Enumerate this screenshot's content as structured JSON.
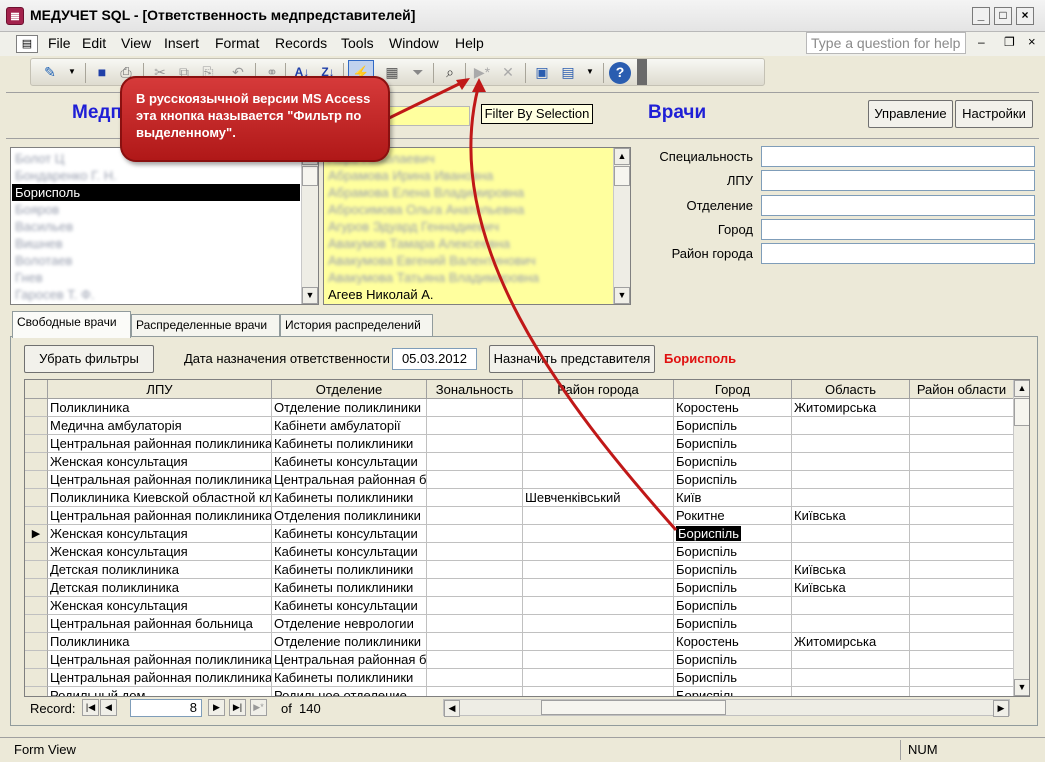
{
  "window": {
    "title": "МЕДУЧЕТ SQL - [Ответственность медпредставителей]",
    "app_icon": "access-form-icon"
  },
  "menu": {
    "items": [
      "File",
      "Edit",
      "View",
      "Insert",
      "Format",
      "Records",
      "Tools",
      "Window",
      "Help"
    ],
    "help_placeholder": "Type a question for help"
  },
  "toolbar": {
    "tooltip": "Filter By Selection",
    "icons": [
      "view-icon",
      "save-icon",
      "print-icon",
      "cut-icon",
      "copy-icon",
      "paste-icon",
      "undo-icon",
      "sort-ascending-icon",
      "sort-descending-icon",
      "filter-by-selection-icon",
      "filter-by-form-icon",
      "apply-filter-icon",
      "find-icon",
      "new-record-icon",
      "delete-record-icon",
      "database-window-icon",
      "new-object-icon",
      "help-icon"
    ]
  },
  "callout": {
    "text": "В русскоязычной версии MS Access эта кнопка называется \"Фильтр по выделенному\"."
  },
  "header": {
    "left_title": "Медп",
    "right_title": "Врачи",
    "btn_manage": "Управление",
    "btn_settings": "Настройки"
  },
  "left_list": {
    "selected": "Борисполь",
    "rows_before": [
      "Болот Ц",
      "Бондаренко Г. Н."
    ],
    "rows_after": [
      "Бояров",
      "Васильев",
      "Вишнев",
      "Волотаев",
      "Гнев",
      "Гаросев Т. Ф."
    ]
  },
  "right_list": {
    "rows": [
      "Абро Николаевич",
      "Абрамова Ирина Ивановна",
      "Абрамова Елена Владимировна",
      "Абросимова Ольга Анатольевна",
      "Агуров Эдуард Геннадиевич",
      "Авакумов Тамара Алексеевна",
      "Авакумова Евгений Валентинович",
      "Авакумова Татьяна Владимировна"
    ],
    "last_row": "Агеев Николай А."
  },
  "details": {
    "labels": [
      "Специальность",
      "ЛПУ",
      "Отделение",
      "Город",
      "Район города"
    ]
  },
  "tabs": [
    "Свободные врачи",
    "Распределенные врачи",
    "История распределений"
  ],
  "filters": {
    "clear_button": "Убрать фильтры",
    "date_label": "Дата назначения ответственности",
    "date_value": "05.03.2012",
    "assign_button": "Назначить представителя",
    "current_city": "Борисполь"
  },
  "grid": {
    "columns": [
      "ЛПУ",
      "Отделение",
      "Зональность",
      "Район города",
      "Город",
      "Область",
      "Район области"
    ],
    "current_row_index": 7,
    "rows": [
      [
        "Поликлиника",
        "Отделение поликлиники",
        "",
        "",
        "Коростень",
        "Житомирська",
        ""
      ],
      [
        "Медична амбулаторія",
        "Кабінети амбулаторії",
        "",
        "",
        "Бориспіль",
        "",
        ""
      ],
      [
        "Центральная районная поликлиника",
        "Кабинеты поликлиники",
        "",
        "",
        "Бориспіль",
        "",
        ""
      ],
      [
        "Женская консультация",
        "Кабинеты консультации",
        "",
        "",
        "Бориспіль",
        "",
        ""
      ],
      [
        "Центральная районная поликлиника",
        "Центральная районная б",
        "",
        "",
        "Бориспіль",
        "",
        ""
      ],
      [
        "Поликлиника Киевской областной кл",
        "Кабинеты поликлиники",
        "",
        "Шевченківський",
        "Київ",
        "",
        ""
      ],
      [
        "Центральная районная поликлиника",
        "Отделения поликлиники",
        "",
        "",
        "Рокитне",
        "Київська",
        ""
      ],
      [
        "Женская консультация",
        "Кабинеты консультации",
        "",
        "",
        "Бориспіль",
        "",
        ""
      ],
      [
        "Женская консультация",
        "Кабинеты консультации",
        "",
        "",
        "Бориспіль",
        "",
        ""
      ],
      [
        "Детская поликлиника",
        "Кабинеты поликлиники",
        "",
        "",
        "Бориспіль",
        "Київська",
        ""
      ],
      [
        "Детская поликлиника",
        "Кабинеты поликлиники",
        "",
        "",
        "Бориспіль",
        "Київська",
        ""
      ],
      [
        "Женская консультация",
        "Кабинеты консультации",
        "",
        "",
        "Бориспіль",
        "",
        ""
      ],
      [
        "Центральная районная больница",
        "Отделение неврологии",
        "",
        "",
        "Бориспіль",
        "",
        ""
      ],
      [
        "Поликлиника",
        "Отделение поликлиники",
        "",
        "",
        "Коростень",
        "Житомирська",
        ""
      ],
      [
        "Центральная районная поликлиника",
        "Центральная районная б",
        "",
        "",
        "Бориспіль",
        "",
        ""
      ],
      [
        "Центральная районная поликлиника",
        "Кабинеты поликлиники",
        "",
        "",
        "Бориспіль",
        "",
        ""
      ],
      [
        "Родильный дом",
        "Родильное отделение",
        "",
        "",
        "Бориспіль",
        "",
        ""
      ]
    ]
  },
  "record_nav": {
    "label": "Record:",
    "current": "8",
    "of_label": "of",
    "total": "140"
  },
  "status": {
    "left": "Form View",
    "right": "NUM"
  },
  "colors": {
    "accent_blue": "#1f1fd6",
    "callout_red": "#c42222",
    "highlight_yellow": "#ffff9e",
    "city_red": "#e01010"
  }
}
